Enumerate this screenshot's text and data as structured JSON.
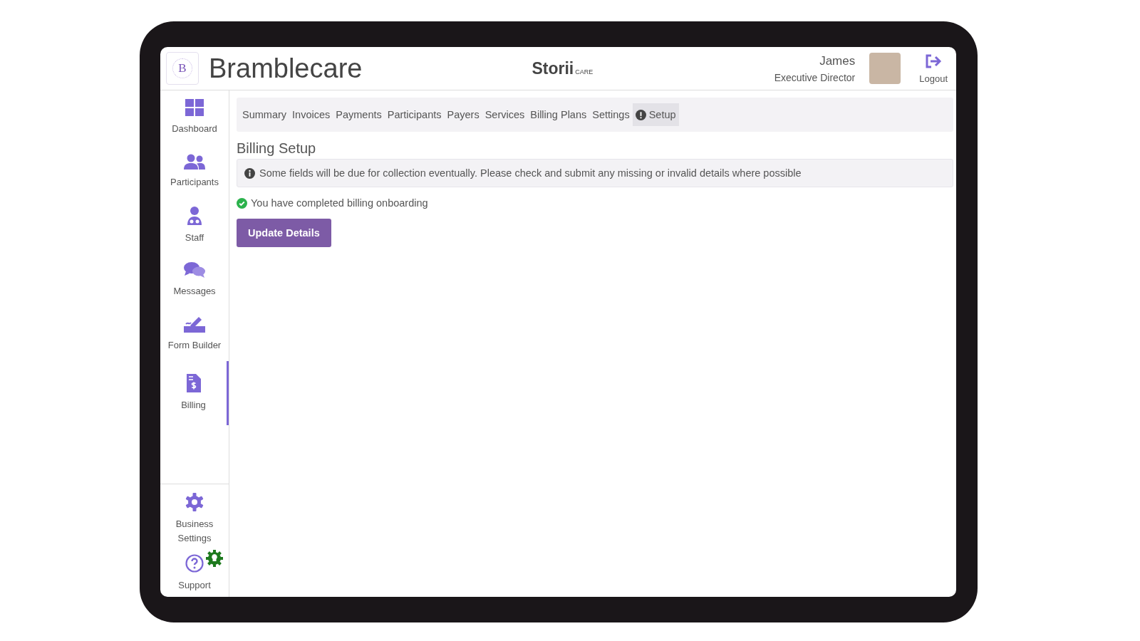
{
  "header": {
    "logo_letter": "B",
    "org_name": "Bramblecare",
    "brand": "Storii",
    "brand_suffix": "CARE",
    "user_name": "James",
    "user_role": "Executive Director",
    "logout": "Logout"
  },
  "sidebar": {
    "items": [
      {
        "label": "Dashboard",
        "selected": false
      },
      {
        "label": "Participants",
        "selected": false
      },
      {
        "label": "Staff",
        "selected": false
      },
      {
        "label": "Messages",
        "selected": false
      },
      {
        "label": "Form Builder",
        "selected": false
      },
      {
        "label": "Billing",
        "selected": true
      }
    ],
    "bottom_items": [
      {
        "label": "Business Settings"
      },
      {
        "label": "Support"
      }
    ]
  },
  "tabs": [
    {
      "label": "Summary",
      "selected": false,
      "alert": false
    },
    {
      "label": "Invoices",
      "selected": false,
      "alert": false
    },
    {
      "label": "Payments",
      "selected": false,
      "alert": false
    },
    {
      "label": "Participants",
      "selected": false,
      "alert": false
    },
    {
      "label": "Payers",
      "selected": false,
      "alert": false
    },
    {
      "label": "Services",
      "selected": false,
      "alert": false
    },
    {
      "label": "Billing Plans",
      "selected": false,
      "alert": false
    },
    {
      "label": "Settings",
      "selected": false,
      "alert": false
    },
    {
      "label": "Setup",
      "selected": true,
      "alert": true
    }
  ],
  "page_title": "Billing Setup",
  "info_notice": "Some fields will be due for collection eventually. Please check and submit any missing or invalid details where possible",
  "status_message": "You have completed billing onboarding",
  "primary_button": "Update Details"
}
